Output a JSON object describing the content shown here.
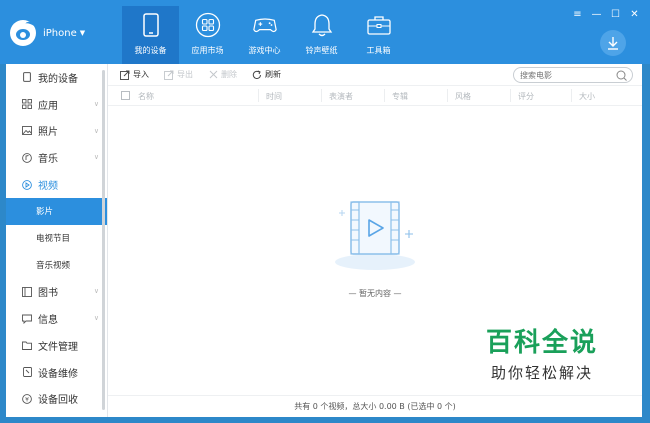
{
  "header": {
    "device_name": "iPhone",
    "nav": [
      {
        "label": "我的设备",
        "icon": "phone-icon"
      },
      {
        "label": "应用市场",
        "icon": "app-grid-icon"
      },
      {
        "label": "游戏中心",
        "icon": "gamepad-icon"
      },
      {
        "label": "铃声壁纸",
        "icon": "bell-icon"
      },
      {
        "label": "工具箱",
        "icon": "toolbox-icon"
      }
    ],
    "active_tab": "我的设备",
    "window_controls": [
      "≡",
      "—",
      "☐",
      "✕"
    ]
  },
  "sidebar": {
    "items": [
      {
        "label": "我的设备",
        "icon": "device-icon"
      },
      {
        "label": "应用",
        "icon": "app-icon"
      },
      {
        "label": "照片",
        "icon": "photo-icon"
      },
      {
        "label": "音乐",
        "icon": "music-icon"
      },
      {
        "label": "视频",
        "icon": "video-icon"
      },
      {
        "label": "影片"
      },
      {
        "label": "电视节目"
      },
      {
        "label": "音乐视频"
      },
      {
        "label": "图书",
        "icon": "book-icon"
      },
      {
        "label": "信息",
        "icon": "message-icon"
      },
      {
        "label": "文件管理",
        "icon": "folder-icon"
      },
      {
        "label": "设备维修",
        "icon": "repair-icon"
      },
      {
        "label": "设备回收",
        "icon": "recycle-icon"
      }
    ],
    "selected": "影片"
  },
  "toolbar": {
    "import": "导入",
    "export": "导出",
    "delete": "删除",
    "refresh": "刷新",
    "search_placeholder": "搜索电影"
  },
  "table": {
    "columns": [
      "名称",
      "时间",
      "表演者",
      "专辑",
      "风格",
      "评分",
      "大小"
    ]
  },
  "empty": {
    "text": "— 暂无内容 —"
  },
  "status": {
    "text": "共有 0 个视频，总大小 0.00 B (已选中 0 个)"
  },
  "watermark": {
    "title": "百科全说",
    "subtitle": "助你轻松解决"
  },
  "colors": {
    "header_bg": "#2c8fde",
    "active_tab_bg": "#1f77c9",
    "accent": "#2c8fde",
    "watermark_green": "#1aa05a"
  }
}
